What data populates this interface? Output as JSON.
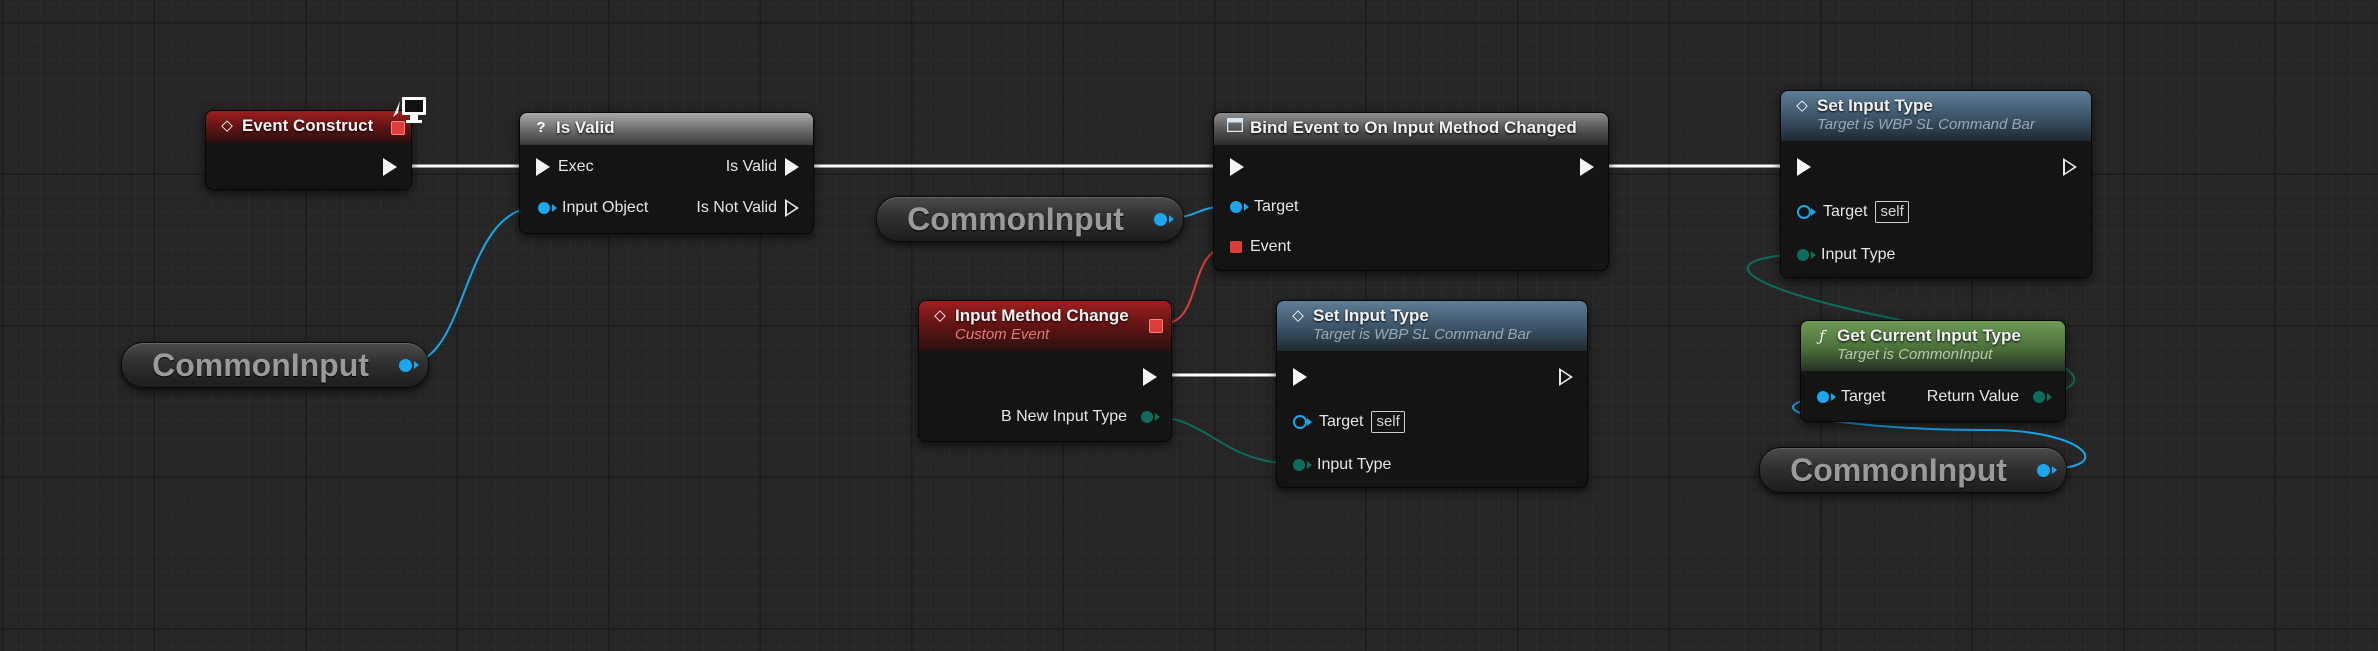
{
  "nodes": {
    "event_construct": {
      "title": "Event Construct"
    },
    "is_valid": {
      "icon": "?",
      "title": "Is Valid",
      "pins": {
        "exec": "Exec",
        "input_object": "Input Object",
        "is_valid": "Is Valid",
        "is_not_valid": "Is Not Valid"
      }
    },
    "bind_event": {
      "title": "Bind Event to On Input Method Changed",
      "pins": {
        "target": "Target",
        "event": "Event"
      }
    },
    "set_input_type_top": {
      "title": "Set Input Type",
      "subtitle": "Target is WBP SL Command Bar",
      "pins": {
        "target": "Target",
        "target_default": "self",
        "input_type": "Input Type"
      }
    },
    "input_method_change": {
      "title": "Input Method Change",
      "subtitle": "Custom Event",
      "pins": {
        "new_input_type": "B New Input Type"
      }
    },
    "set_input_type_bottom": {
      "title": "Set Input Type",
      "subtitle": "Target is WBP SL Command Bar",
      "pins": {
        "target": "Target",
        "target_default": "self",
        "input_type": "Input Type"
      }
    },
    "get_current_input_type": {
      "icon": "ƒ",
      "title": "Get Current Input Type",
      "subtitle": "Target is CommonInput",
      "pins": {
        "target": "Target",
        "return_value": "Return Value"
      }
    }
  },
  "variables": {
    "common_input_left": "CommonInput",
    "common_input_middle": "CommonInput",
    "common_input_right": "CommonInput"
  },
  "colors": {
    "exec_wire": "#ffffff",
    "object_wire": "#1aa7ec",
    "enum_wire": "#0c6d5c",
    "delegate_wire": "#e03b3b"
  },
  "icons": {
    "event": "event-diamond-icon",
    "branch": "question-icon",
    "function": "function-icon",
    "client": "monitor-icon"
  }
}
